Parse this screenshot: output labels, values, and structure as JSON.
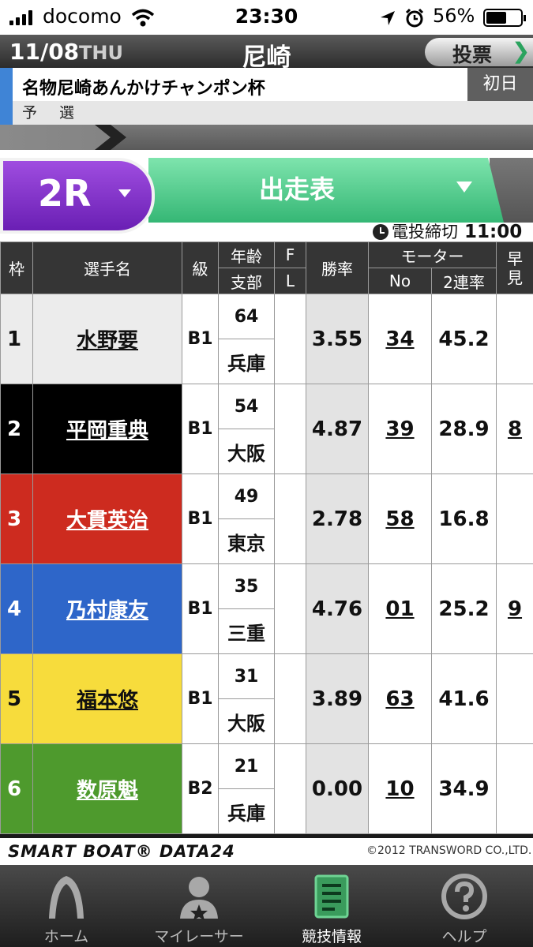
{
  "status": {
    "carrier": "docomo",
    "time": "23:30",
    "battery": "56%"
  },
  "header": {
    "date": "11/08",
    "dow": "THU",
    "venue": "尼崎",
    "vote_label": "投票",
    "vote_arrow": "❯"
  },
  "race": {
    "title": "名物尼崎あんかけチャンポン杯",
    "day": "初日",
    "stage": "予選"
  },
  "selector": {
    "race_no": "2R",
    "view": "出走表"
  },
  "deadline": {
    "label": "電投締切",
    "time": "11:00"
  },
  "table": {
    "headers": {
      "waku": "枠",
      "name": "選手名",
      "class": "級",
      "age": "年齢",
      "branch": "支部",
      "f": "F",
      "l": "L",
      "rate": "勝率",
      "motor": "モーター",
      "motor_no": "No",
      "motor_rate": "2連率",
      "early1": "早",
      "early2": "見"
    },
    "rows": [
      {
        "waku": "1",
        "name": "水野要",
        "class": "B1",
        "age": "64",
        "branch": "兵庫",
        "rate": "3.55",
        "motor_no": "34",
        "motor_rate": "45.2",
        "early": ""
      },
      {
        "waku": "2",
        "name": "平岡重典",
        "class": "B1",
        "age": "54",
        "branch": "大阪",
        "rate": "4.87",
        "motor_no": "39",
        "motor_rate": "28.9",
        "early": "8"
      },
      {
        "waku": "3",
        "name": "大貫英治",
        "class": "B1",
        "age": "49",
        "branch": "東京",
        "rate": "2.78",
        "motor_no": "58",
        "motor_rate": "16.8",
        "early": ""
      },
      {
        "waku": "4",
        "name": "乃村康友",
        "class": "B1",
        "age": "35",
        "branch": "三重",
        "rate": "4.76",
        "motor_no": "01",
        "motor_rate": "25.2",
        "early": "9"
      },
      {
        "waku": "5",
        "name": "福本悠",
        "class": "B1",
        "age": "31",
        "branch": "大阪",
        "rate": "3.89",
        "motor_no": "63",
        "motor_rate": "41.6",
        "early": ""
      },
      {
        "waku": "6",
        "name": "数原魁",
        "class": "B2",
        "age": "21",
        "branch": "兵庫",
        "rate": "0.00",
        "motor_no": "10",
        "motor_rate": "34.9",
        "early": ""
      }
    ]
  },
  "footer": {
    "logo": "SMART BOAT® DATA24",
    "copyright": "©2012 TRANSWORD CO.,LTD."
  },
  "tabs": [
    {
      "label": "ホーム",
      "icon": "home-icon"
    },
    {
      "label": "マイレーサー",
      "icon": "my-racer-icon"
    },
    {
      "label": "競技情報",
      "icon": "race-info-icon"
    },
    {
      "label": "ヘルプ",
      "icon": "help-icon"
    }
  ]
}
